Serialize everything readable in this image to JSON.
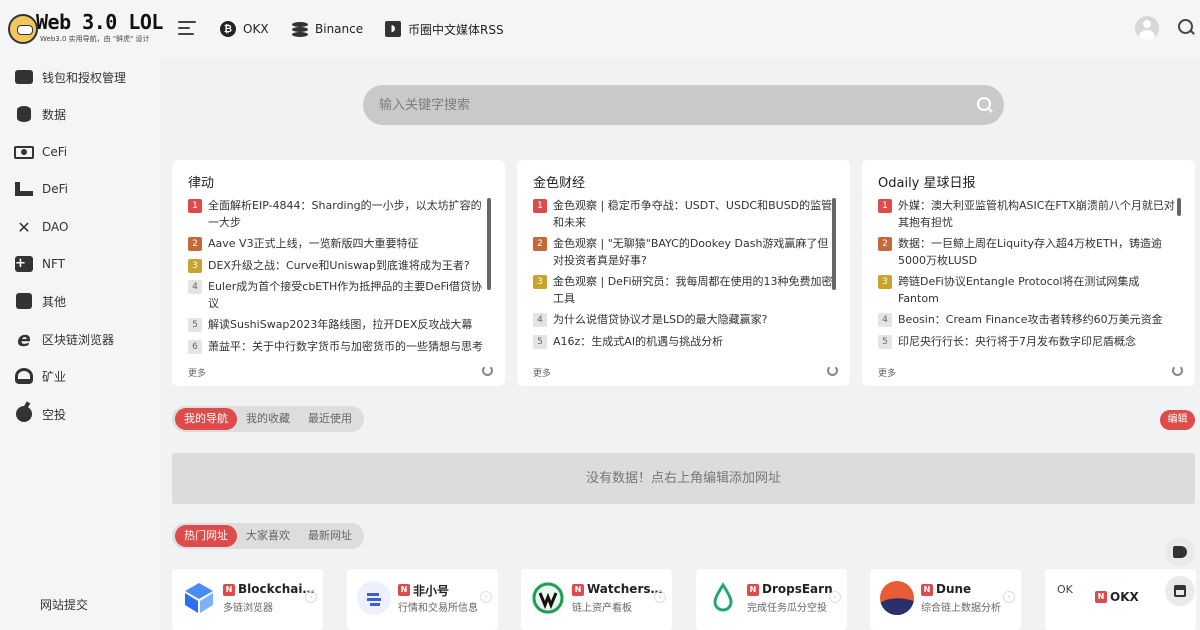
{
  "header": {
    "logo_title": "Web 3.0 LOL",
    "logo_subtitle": "Web3.0 实用导航，由 \"鲜虎\" 设计",
    "links": [
      {
        "label": "OKX",
        "icon": "bitcoin-icon"
      },
      {
        "label": "Binance",
        "icon": "coins-icon"
      },
      {
        "label": "币圈中文媒体RSS",
        "icon": "rss-icon"
      }
    ]
  },
  "sidebar": {
    "items": [
      {
        "label": "钱包和授权管理",
        "icon": "wallet-icon"
      },
      {
        "label": "数据",
        "icon": "database-icon"
      },
      {
        "label": "CeFi",
        "icon": "cash-icon"
      },
      {
        "label": "DeFi",
        "icon": "defi-icon"
      },
      {
        "label": "DAO",
        "icon": "dao-icon"
      },
      {
        "label": "NFT",
        "icon": "nft-icon"
      },
      {
        "label": "其他",
        "icon": "other-icon"
      },
      {
        "label": "区块链浏览器",
        "icon": "browser-icon"
      },
      {
        "label": "矿业",
        "icon": "mining-icon"
      },
      {
        "label": "空投",
        "icon": "airdrop-icon"
      }
    ],
    "submit": "网站提交"
  },
  "search": {
    "placeholder": "输入关键字搜索"
  },
  "news": [
    {
      "title": "律动",
      "more": "更多",
      "items": [
        "全面解析EIP-4844：Sharding的一小步，以太坊扩容的一大步",
        "Aave V3正式上线，一览新版四大重要特征",
        "DEX升级之战：Curve和Uniswap到底谁将成为王者?",
        "Euler成为首个接受cbETH作为抵押品的主要DeFi借贷协议",
        "解读SushiSwap2023年路线图，拉开DEX反攻战大幕",
        "萧益平：关于中行数字货币与加密货币的一些猜想与思考"
      ]
    },
    {
      "title": "金色财经",
      "more": "更多",
      "items": [
        "金色观察 | 稳定币争夺战：USDT、USDC和BUSD的监管和未来",
        "金色观察 | \"无聊猿\"BAYC的Dookey Dash游戏赢麻了但对投资者真是好事?",
        "金色观察 | DeFi研究员：我每周都在使用的13种免费加密工具",
        "为什么说借贷协议才是LSD的最大隐藏赢家?",
        "A16z：生成式AI的机遇与挑战分析"
      ]
    },
    {
      "title": "Odaily 星球日报",
      "more": "更多",
      "items": [
        "外媒：澳大利亚监管机构ASIC在FTX崩溃前八个月就已对其抱有担忧",
        "数据：一巨鲸上周在Liquity存入超4万枚ETH，铸造逾5000万枚LUSD",
        "跨链DeFi协议Entangle Protocol将在测试网集成Fantom",
        "Beosin：Cream Finance攻击者转移约60万美元资金",
        "印尼央行行长：央行将于7月发布数字印尼盾概念"
      ]
    }
  ],
  "nav_tabs": [
    "我的导航",
    "我的收藏",
    "最近使用"
  ],
  "edit_label": "编辑",
  "empty_message": "没有数据！点右上角编辑添加网址",
  "site_tabs": [
    "热门网址",
    "大家喜欢",
    "最新网址"
  ],
  "sites": [
    {
      "name": "Blockchain.com",
      "desc": "多链浏览器",
      "badge": "N",
      "logo_color": "#2d6ff0"
    },
    {
      "name": "非小号",
      "desc": "行情和交易所信息",
      "badge": "N",
      "logo_color": "#eef1fb"
    },
    {
      "name": "Watchers.pro",
      "desc": "链上资产看板",
      "badge": "N",
      "logo_color": "#eaf6ef"
    },
    {
      "name": "DropsEarn",
      "desc": "完成任务瓜分空投",
      "badge": "N",
      "logo_color": "#eaf8f0"
    },
    {
      "name": "Dune",
      "desc": "综合链上数据分析",
      "badge": "N",
      "logo_color": "#e85b33"
    },
    {
      "name": "OKX",
      "desc": "",
      "badge": "N",
      "logo_alt": "OK",
      "logo_color": "#ffffff"
    }
  ],
  "colors": {
    "accent": "#dd4b4b",
    "background": "#f1f2f3",
    "card": "#ffffff"
  }
}
